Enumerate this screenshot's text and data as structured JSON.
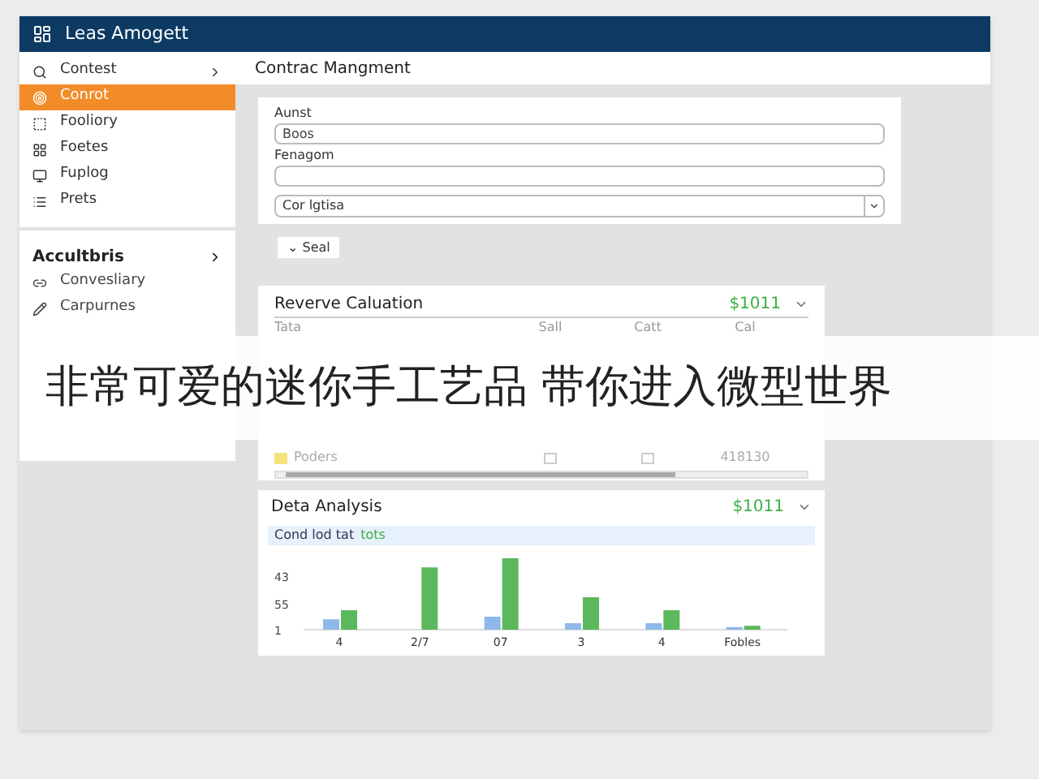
{
  "window": {
    "title": "Leas Amogett"
  },
  "sidebar": {
    "items": [
      {
        "label": "Contest",
        "kind": "search",
        "selected": false
      },
      {
        "label": "Conrot",
        "kind": "target",
        "selected": true
      },
      {
        "label": "Fooliory",
        "kind": "box",
        "selected": false
      },
      {
        "label": "Foetes",
        "kind": "grid",
        "selected": false
      },
      {
        "label": "Fuplog",
        "kind": "screen",
        "selected": false
      },
      {
        "label": "Prets",
        "kind": "list",
        "selected": false
      }
    ],
    "section": {
      "title": "Accultbris",
      "items": [
        {
          "label": "Convesliary",
          "kind": "link"
        },
        {
          "label": "Carpurnes",
          "kind": "pen"
        }
      ]
    }
  },
  "header": {
    "title": "Contrac Mangment"
  },
  "form": {
    "fields": [
      {
        "label": "Aunst",
        "value": "Boos"
      },
      {
        "label": "Fenagom"
      }
    ],
    "select": {
      "value": "Cor lgtisa"
    },
    "button": "Seal",
    "caret": "⌄"
  },
  "revenue": {
    "title": "Reverve Caluation",
    "amount": "$1011",
    "columns": [
      "Tata",
      "Sall",
      "Catt",
      "Cal"
    ],
    "rows": [
      {
        "name": "Poders",
        "color": "#f5e27a",
        "checked_1": false,
        "checked_2": false,
        "value": "418130"
      }
    ]
  },
  "analysis": {
    "title": "Deta Analysis",
    "amount": "$1011",
    "legend": "Cond lod tat",
    "legend_accent": "tots",
    "chart": {
      "x_labels": [
        "4",
        "2/7",
        "07",
        "3",
        "4",
        "Fobles"
      ],
      "y_labels": [
        "43",
        "55",
        "1"
      ]
    }
  },
  "banner": {
    "text": "非常可爱的迷你手工艺品 带你进入微型世界"
  }
}
